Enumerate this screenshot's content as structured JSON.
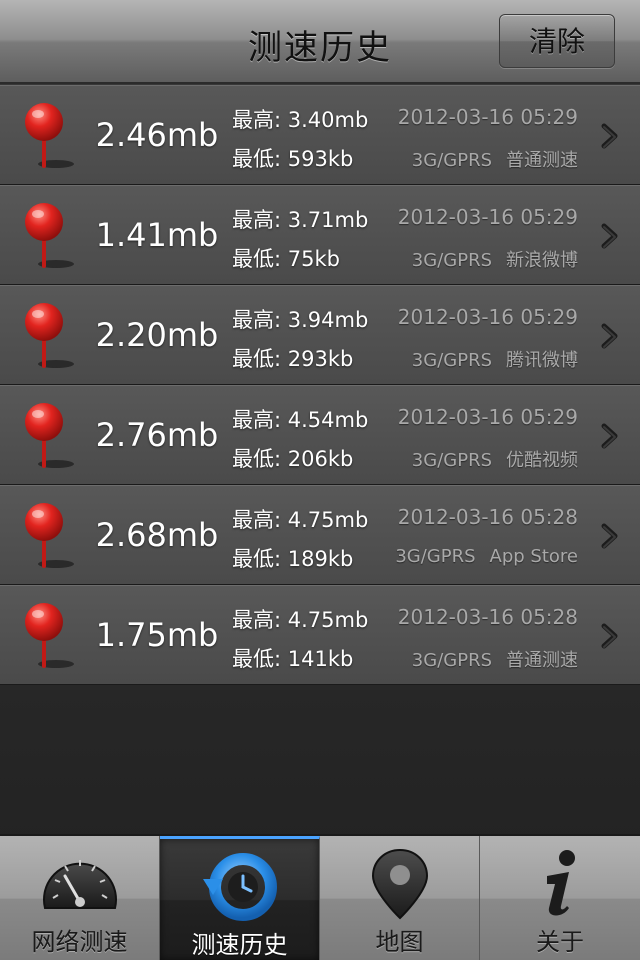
{
  "navbar": {
    "title": "测速历史",
    "clear_label": "清除"
  },
  "records": [
    {
      "speed": "2.46mb",
      "max": "最高: 3.40mb",
      "min": "最低: 593kb",
      "datetime": "2012-03-16 05:29",
      "network": "3G/GPRS",
      "source": "普通测速"
    },
    {
      "speed": "1.41mb",
      "max": "最高: 3.71mb",
      "min": "最低: 75kb",
      "datetime": "2012-03-16 05:29",
      "network": "3G/GPRS",
      "source": "新浪微博"
    },
    {
      "speed": "2.20mb",
      "max": "最高: 3.94mb",
      "min": "最低: 293kb",
      "datetime": "2012-03-16 05:29",
      "network": "3G/GPRS",
      "source": "腾讯微博"
    },
    {
      "speed": "2.76mb",
      "max": "最高: 4.54mb",
      "min": "最低: 206kb",
      "datetime": "2012-03-16 05:29",
      "network": "3G/GPRS",
      "source": "优酷视频"
    },
    {
      "speed": "2.68mb",
      "max": "最高: 4.75mb",
      "min": "最低: 189kb",
      "datetime": "2012-03-16 05:28",
      "network": "3G/GPRS",
      "source": "App Store"
    },
    {
      "speed": "1.75mb",
      "max": "最高: 4.75mb",
      "min": "最低: 141kb",
      "datetime": "2012-03-16 05:28",
      "network": "3G/GPRS",
      "source": "普通测速"
    }
  ],
  "icons": {
    "row_marker": "map-pin-icon",
    "row_disclosure": "chevron-right-icon"
  },
  "tabs": [
    {
      "label": "网络测速",
      "icon": "speedometer-icon",
      "active": false
    },
    {
      "label": "测速历史",
      "icon": "history-clock-icon",
      "active": true
    },
    {
      "label": "地图",
      "icon": "map-pin-icon",
      "active": false
    },
    {
      "label": "关于",
      "icon": "info-icon",
      "active": false
    }
  ],
  "colors": {
    "pin_red": "#e2241f",
    "active_tab_blue": "#2b8fe8"
  }
}
